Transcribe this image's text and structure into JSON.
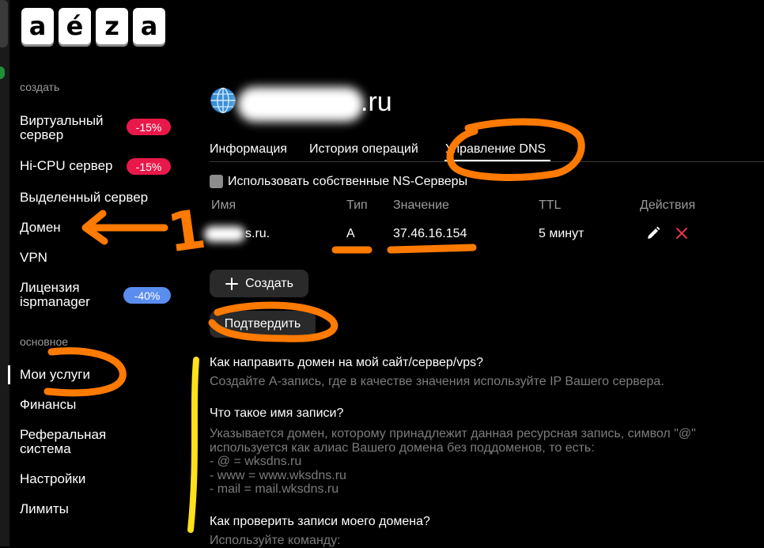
{
  "logo": {
    "letters": [
      "a",
      "é",
      "z",
      "a"
    ]
  },
  "sidebar": {
    "section_create": "создать",
    "create_items": [
      {
        "label": "Виртуальный\nсервер",
        "badge": "-15%"
      },
      {
        "label": "Hi-CPU сервер",
        "badge": "-15%"
      },
      {
        "label": "Выделенный сервер"
      },
      {
        "label": "Домен"
      },
      {
        "label": "VPN"
      },
      {
        "label": "Лицензия\nispmanager",
        "badge": "-40%"
      }
    ],
    "section_main": "основное",
    "main_items": [
      {
        "label": "Мои услуги",
        "active": true
      },
      {
        "label": "Финансы"
      },
      {
        "label": "Реферальная\nсистема"
      },
      {
        "label": "Настройки"
      },
      {
        "label": "Лимиты"
      }
    ],
    "badge_colors": {
      "red": "#e8194a",
      "blue": "#5b8def"
    }
  },
  "domain": {
    "suffix": ".ru"
  },
  "tabs": [
    "Информация",
    "История операций",
    "Управление DNS"
  ],
  "active_tab": "Управление DNS",
  "ns_checkbox_label": "Использовать собственные NS-Серверы",
  "dns_table": {
    "headers": [
      "Имя",
      "Тип",
      "Значение",
      "TTL",
      "Действия"
    ],
    "rows": [
      {
        "name_visible": "s.ru.",
        "type": "A",
        "value": "37.46.16.154",
        "ttl": "5 минут"
      }
    ]
  },
  "buttons": {
    "create": "Создать",
    "confirm": "Подтвердить"
  },
  "faq": [
    {
      "q": "Как направить домен на мой сайт/сервер/vps?",
      "a": "Создайте А-запись, где в качестве значения используйте IP Вашего сервера."
    },
    {
      "q": "Что такое имя записи?",
      "a": "Указывается домен, которому принадлежит данная ресурсная запись, символ \"@\"\nиспользуется как алиас Вашего домена без поддоменов, то есть:\n- @ = wksdns.ru\n- www = www.wksdns.ru\n- mail = mail.wksdns.ru"
    },
    {
      "q": "Как проверить записи моего домена?",
      "a": "Используйте команду:"
    }
  ],
  "annotations": {
    "arrow_number": "1",
    "orange": "#ff7a00",
    "yellow": "#ffe11a"
  }
}
